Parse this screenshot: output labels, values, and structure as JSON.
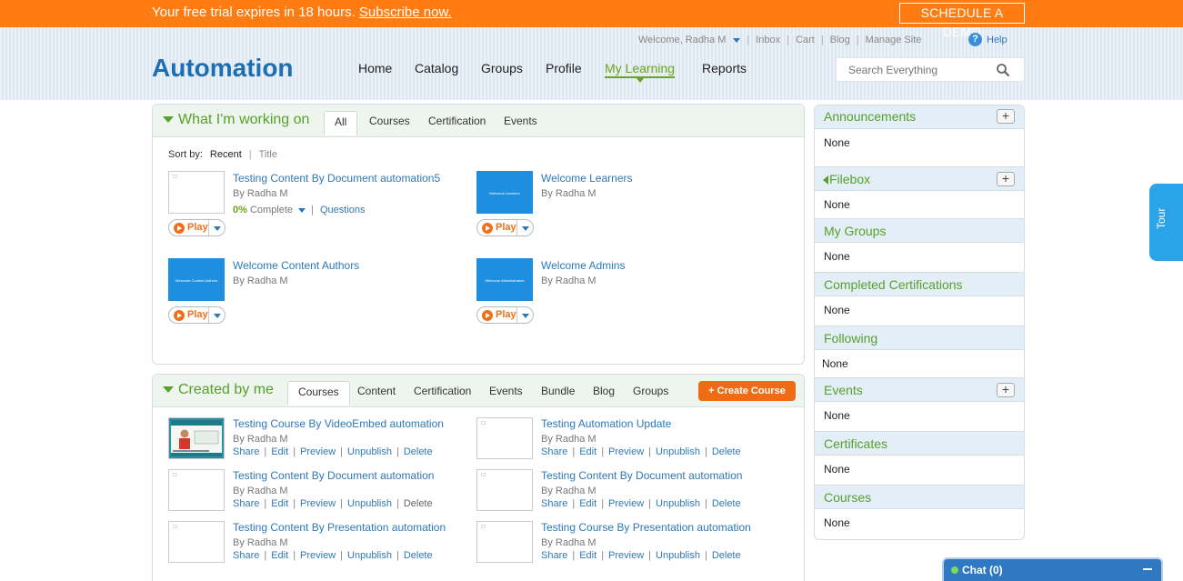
{
  "trial": {
    "message": "Your free trial expires in 18 hours.",
    "subscribe_link": "Subscribe now.",
    "demo_button": "SCHEDULE A DEMO"
  },
  "top_links": {
    "welcome": "Welcome, Radha M",
    "inbox": "Inbox",
    "cart": "Cart",
    "blog": "Blog",
    "manage_site": "Manage Site",
    "help": "Help",
    "help_icon": "?"
  },
  "logo": "Automation",
  "nav": {
    "home": "Home",
    "catalog": "Catalog",
    "groups": "Groups",
    "profile": "Profile",
    "my_learning": "My Learning",
    "reports": "Reports"
  },
  "search": {
    "placeholder": "Search Everything"
  },
  "working_on": {
    "title": "What I'm working on",
    "tabs": [
      "All",
      "Courses",
      "Certification",
      "Events"
    ],
    "sort_by": {
      "label": "Sort by:",
      "recent": "Recent",
      "title": "Title"
    },
    "items": [
      {
        "title": "Testing Content By Document automation5",
        "author": "By Radha M",
        "progress_pct": "0%",
        "progress_label": "Complete",
        "questions": "Questions",
        "play": "Play"
      },
      {
        "title": "Welcome Learners",
        "author": "By Radha M",
        "thumb_text": "Welcome Learners",
        "play": "Play"
      },
      {
        "title": "Welcome Content Authors",
        "author": "By Radha M",
        "thumb_text": "Welcome Content Authors",
        "play": "Play"
      },
      {
        "title": "Welcome Admins",
        "author": "By Radha M",
        "thumb_text": "Welcome Administrators",
        "play": "Play"
      }
    ]
  },
  "created_by_me": {
    "title": "Created by me",
    "tabs": [
      "Courses",
      "Content",
      "Certification",
      "Events",
      "Bundle",
      "Blog",
      "Groups"
    ],
    "create_button": "+ Create Course",
    "items": [
      {
        "title": "Testing Course By VideoEmbed automation",
        "author": "By Radha M",
        "actions": [
          "Share",
          "Edit",
          "Preview",
          "Unpublish",
          "Delete"
        ]
      },
      {
        "title": "Testing Automation Update",
        "author": "By Radha M",
        "actions": [
          "Share",
          "Edit",
          "Preview",
          "Unpublish",
          "Delete"
        ]
      },
      {
        "title": "Testing Content By Document automation",
        "author": "By Radha M",
        "actions": [
          "Share",
          "Edit",
          "Preview",
          "Unpublish",
          "Delete"
        ]
      },
      {
        "title": "Testing Content By Document automation",
        "author": "By Radha M",
        "actions": [
          "Share",
          "Edit",
          "Preview",
          "Unpublish",
          "Delete"
        ]
      },
      {
        "title": "Testing Content By Presentation automation",
        "author": "By Radha M",
        "actions": [
          "Share",
          "Edit",
          "Preview",
          "Unpublish",
          "Delete"
        ]
      },
      {
        "title": "Testing Course By Presentation automation",
        "author": "By Radha M",
        "actions": [
          "Share",
          "Edit",
          "Preview",
          "Unpublish",
          "Delete"
        ]
      }
    ]
  },
  "sidebar": [
    {
      "title": "Announcements",
      "value": "None",
      "plus": "+"
    },
    {
      "title": "Filebox",
      "value": "None",
      "plus": "+"
    },
    {
      "title": "My Groups",
      "value": "None"
    },
    {
      "title": "Completed Certifications",
      "value": "None"
    },
    {
      "title": "Following",
      "value": "None"
    },
    {
      "title": "Events",
      "value": "None",
      "plus": "+"
    },
    {
      "title": "Certificates",
      "value": "None"
    },
    {
      "title": "Courses",
      "value": "None"
    }
  ],
  "tour": "Tour",
  "chat": {
    "label": "Chat  (0)"
  }
}
